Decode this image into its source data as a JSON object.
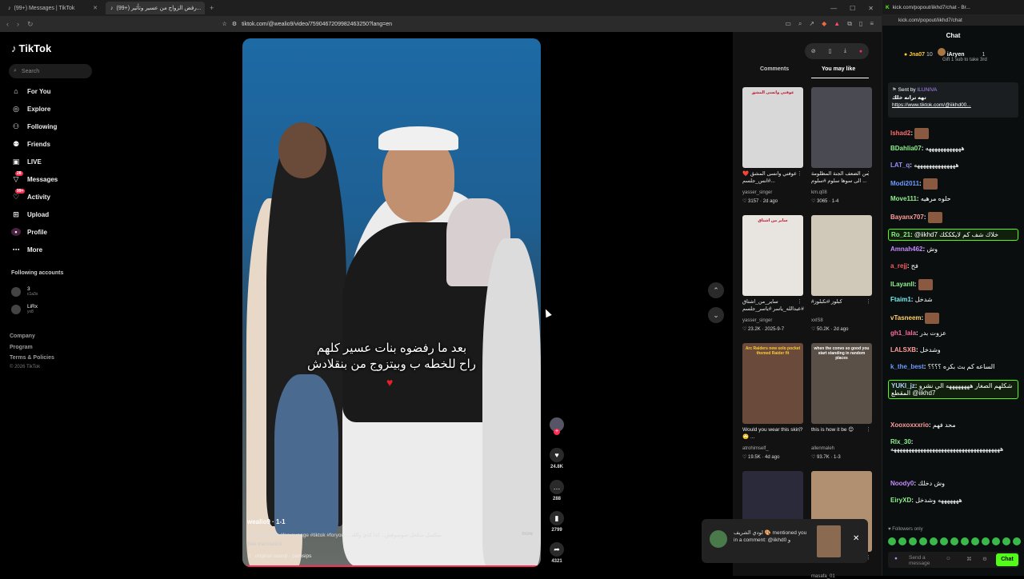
{
  "browser": {
    "tabs": [
      {
        "label": "(99+) Messages | TikTok",
        "active": false
      },
      {
        "label": "(99+) رفض الزواج من عسير وتأثير...",
        "active": true
      }
    ],
    "url": "tiktok.com/@wealio9/video/7590467209982463250?lang=en"
  },
  "sidebar": {
    "logo": "TikTok",
    "search_placeholder": "Search",
    "nav": [
      {
        "label": "For You",
        "icon": "home-icon"
      },
      {
        "label": "Explore",
        "icon": "compass-icon"
      },
      {
        "label": "Following",
        "icon": "following-icon"
      },
      {
        "label": "Friends",
        "icon": "friends-icon"
      },
      {
        "label": "LIVE",
        "icon": "live-icon"
      },
      {
        "label": "Messages",
        "icon": "messages-icon",
        "badge": "28"
      },
      {
        "label": "Activity",
        "icon": "activity-icon",
        "badge": "99+"
      },
      {
        "label": "Upload",
        "icon": "upload-icon"
      },
      {
        "label": "Profile",
        "icon": "profile-icon"
      },
      {
        "label": "More",
        "icon": "more-icon"
      }
    ],
    "following_header": "Following accounts",
    "accounts": [
      {
        "name": "3",
        "sub": "c1a3s"
      },
      {
        "name": "LiRx",
        "sub": "yx8"
      }
    ],
    "footer": [
      "Company",
      "Program",
      "Terms & Policies"
    ],
    "copyright": "© 2026 TikTok"
  },
  "video": {
    "caption_line1": "بعد ما رفضوه بنات عسير كلهم",
    "caption_line2": "راح للخطه ب وبيتزوج من بنقلادش",
    "username": "wealio9 · 1-1",
    "description": "#explore #fyp #foryoupage #tiktok #foryou ... متكسل متكحل سوسوهش ، كذا كذي والله",
    "more": "more",
    "see_translation": "See translation",
    "sound": "original sound - pamsips",
    "progress": 1.0
  },
  "actions": [
    {
      "name": "like",
      "icon": "heart-icon",
      "count": "24.8K"
    },
    {
      "name": "comment",
      "icon": "comment-icon",
      "count": "288"
    },
    {
      "name": "save",
      "icon": "bookmark-icon",
      "count": "2799"
    },
    {
      "name": "share",
      "icon": "share-icon",
      "count": "4321"
    }
  ],
  "right_panel": {
    "tabs": [
      "Comments",
      "You may like"
    ],
    "active_tab": "You may like",
    "items": [
      {
        "caption": "عوفني وانسى المشق ❤️ ...#انس_جلسم",
        "user": "yasser_singer",
        "likes": "3157",
        "date": "2d ago",
        "bg": "#d8d8d8"
      },
      {
        "caption": "من الضعف الجنة المظلومة الى سوها سلوم #سلوم ...",
        "user": "km.q08",
        "likes": "3065",
        "date": "1-4",
        "bg": "#4a4a52"
      },
      {
        "caption": "ساير_من_اشتاق #عبدالله_ياسر #ياسر_جلسم",
        "user": "yasser_singer",
        "likes": "23.2K",
        "date": "2025-9-7",
        "bg": "#e8e4e0"
      },
      {
        "caption": "#كبلوز #تكبلوز",
        "user": "xxlS8",
        "likes": "50.2K",
        "date": "2d ago",
        "bg": "#d0c8b8"
      },
      {
        "caption": "Would you wear this skin? 🙄 ...",
        "user": "atrohimself_",
        "likes": "19.5K",
        "date": "4d ago",
        "bg": "#6a4a3a"
      },
      {
        "caption": "this is how it be 😊",
        "user": "allenmaleh",
        "likes": "93.7K",
        "date": "1-3",
        "bg": "#5a5048"
      },
      {
        "caption": "",
        "user": "",
        "likes": "",
        "date": "",
        "bg": "#2a2a3a"
      },
      {
        "caption": "",
        "user": "masafa_01",
        "likes": "",
        "date": "",
        "bg": "#b09070"
      }
    ],
    "thumb_texts": [
      "عوفني وانسى المشق",
      "",
      "ساير من اشتاق",
      "",
      "Arc Raiders new solo pocket themed Raider fit",
      "when the convo so good you start standing in random places",
      "",
      ""
    ]
  },
  "notification": {
    "text": "لودي الشريف 🎨 mentioned you in a comment: @iikhd0 و"
  },
  "kick": {
    "window_title": "kick.com/popout/iikhd7/chat - Br...",
    "url": "kick.com/popout/iikhd7/chat",
    "chat_title": "Chat",
    "top_user1": "Jna07",
    "top_user1_count": "10",
    "top_user2": "iAryen",
    "top_user2_sub": "Gift 1 sub to take 3rd",
    "top_user2_count": "1",
    "pinned_by": "Sent by",
    "pinned_user": "ILUNIVA",
    "pinned_title": "تهه ترانه خلك",
    "pinned_link": "https://www.tiktok.com/@iikhd00...",
    "messages": [
      {
        "user": "lshad2",
        "text": "",
        "color": "#ff6b6b"
      },
      {
        "user": "BDahlia07",
        "text": "ههههههههههههه",
        "color": "#8ef28e"
      },
      {
        "user": "LAT_q",
        "text": "ههههههههههههههه",
        "color": "#9b8bff"
      },
      {
        "user": "Modi2011",
        "text": "",
        "color": "#6c9bff"
      },
      {
        "user": "Move111",
        "text": "حلوه مرهيه",
        "color": "#8ef28e"
      },
      {
        "user": "Bayanx707",
        "text": "",
        "color": "#ff9d9d"
      },
      {
        "user": "Ro_21",
        "text": "@iikhd7 خلاك شف كم لايكككك",
        "color": "#8ef28e",
        "boxed": true
      },
      {
        "user": "Amnah462",
        "text": "وش",
        "color": "#c48bff"
      },
      {
        "user": "a_rejj",
        "text": "فح",
        "color": "#ff5b5b"
      },
      {
        "user": "lLayanll",
        "text": "",
        "color": "#8ef28e"
      },
      {
        "user": "Ftaim1",
        "text": "شدخل",
        "color": "#6cf2f2"
      },
      {
        "user": "vTasneem",
        "text": "",
        "color": "#ffcf6b"
      },
      {
        "user": "gh1_lala",
        "text": "عزوت بدر",
        "color": "#ff6b9b"
      },
      {
        "user": "LALSXB",
        "text": "وشدخل",
        "color": "#ff9d9d"
      },
      {
        "user": "k_the_best",
        "text": "الساعه كم بث بكره ؟؟؟؟",
        "color": "#6c9bff"
      },
      {
        "user": "YUKI_jz",
        "text": "شكلهم الصغار ههههههههه الي نشرو المقطع @iikhd7",
        "color": "#b0d0ff",
        "boxed": true
      },
      {
        "user": "Xooxoxxxrio",
        "text": "محد فهم",
        "color": "#ff9d9d"
      },
      {
        "user": "Rlx_30",
        "text": "هههههههههههههههههههههههههههههههههههههه",
        "color": "#8ef28e"
      },
      {
        "user": "Noody0",
        "text": "وش دخلك",
        "color": "#c48bff"
      },
      {
        "user": "EiryXD",
        "text": "هههههههه وشدخل",
        "color": "#8ef28e"
      }
    ],
    "followers_only": "Followers only",
    "input_placeholder": "Send a message",
    "chat_button": "Chat"
  }
}
